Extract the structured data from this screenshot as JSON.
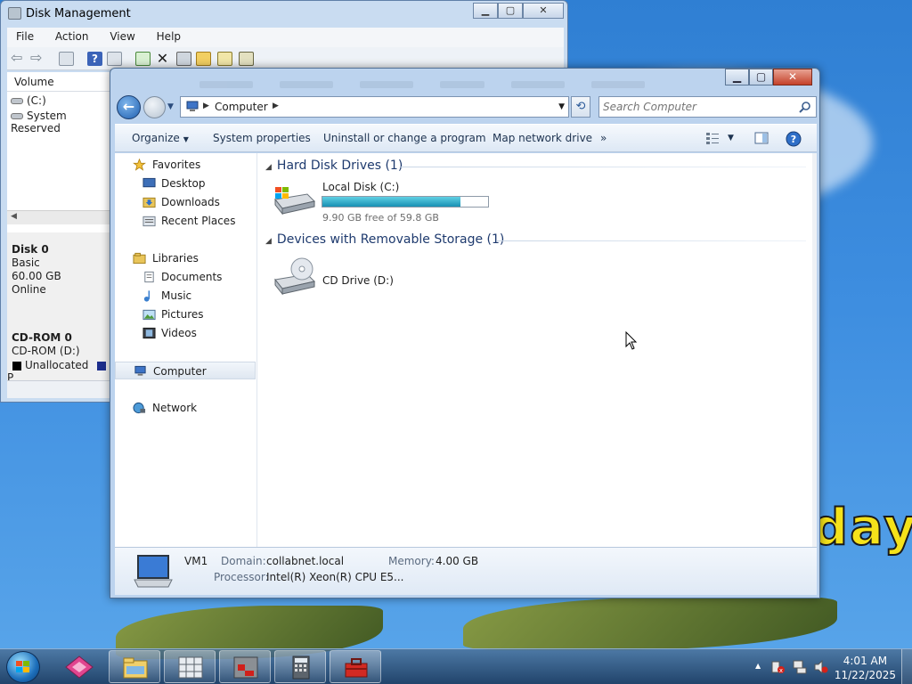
{
  "disk_management": {
    "title": "Disk Management",
    "menu": [
      "File",
      "Action",
      "View",
      "Help"
    ],
    "column_header": "Volume",
    "volumes": [
      "(C:)",
      "System Reserved"
    ],
    "disks": [
      {
        "name": "Disk 0",
        "type": "Basic",
        "size": "60.00 GB",
        "status": "Online"
      },
      {
        "name": "CD-ROM 0",
        "type": "CD-ROM (D:)"
      }
    ],
    "legend": [
      "Unallocated",
      "P"
    ]
  },
  "explorer": {
    "breadcrumb": [
      "Computer"
    ],
    "search_placeholder": "Search Computer",
    "commands": {
      "organize": "Organize",
      "system_properties": "System properties",
      "uninstall": "Uninstall or change a program",
      "map_drive": "Map network drive",
      "more": "»"
    },
    "nav": {
      "favorites": "Favorites",
      "desktop": "Desktop",
      "downloads": "Downloads",
      "recent": "Recent Places",
      "libraries": "Libraries",
      "documents": "Documents",
      "music": "Music",
      "pictures": "Pictures",
      "videos": "Videos",
      "computer": "Computer",
      "network": "Network"
    },
    "groups": {
      "hdd": "Hard Disk Drives (1)",
      "removable": "Devices with Removable Storage (1)"
    },
    "drives": {
      "local_disk": {
        "name": "Local Disk (C:)",
        "free_text": "9.90 GB free of 59.8 GB",
        "used_fraction": 0.834
      },
      "cd_drive": {
        "name": "CD Drive (D:)"
      }
    },
    "details": {
      "computer_name": "VM1",
      "domain_label": "Domain:",
      "domain": "collabnet.local",
      "memory_label": "Memory:",
      "memory": "4.00 GB",
      "processor_label": "Processor:",
      "processor": "Intel(R) Xeon(R) CPU E5..."
    }
  },
  "wallpaper_text": "day",
  "taskbar": {
    "time": "4:01 AM",
    "date": "11/22/2025",
    "show_hidden": "▲"
  },
  "colors": {
    "accent": "#1f5fb0",
    "usage_bar": "#1790b3",
    "group_header": "#1e3a6e"
  }
}
